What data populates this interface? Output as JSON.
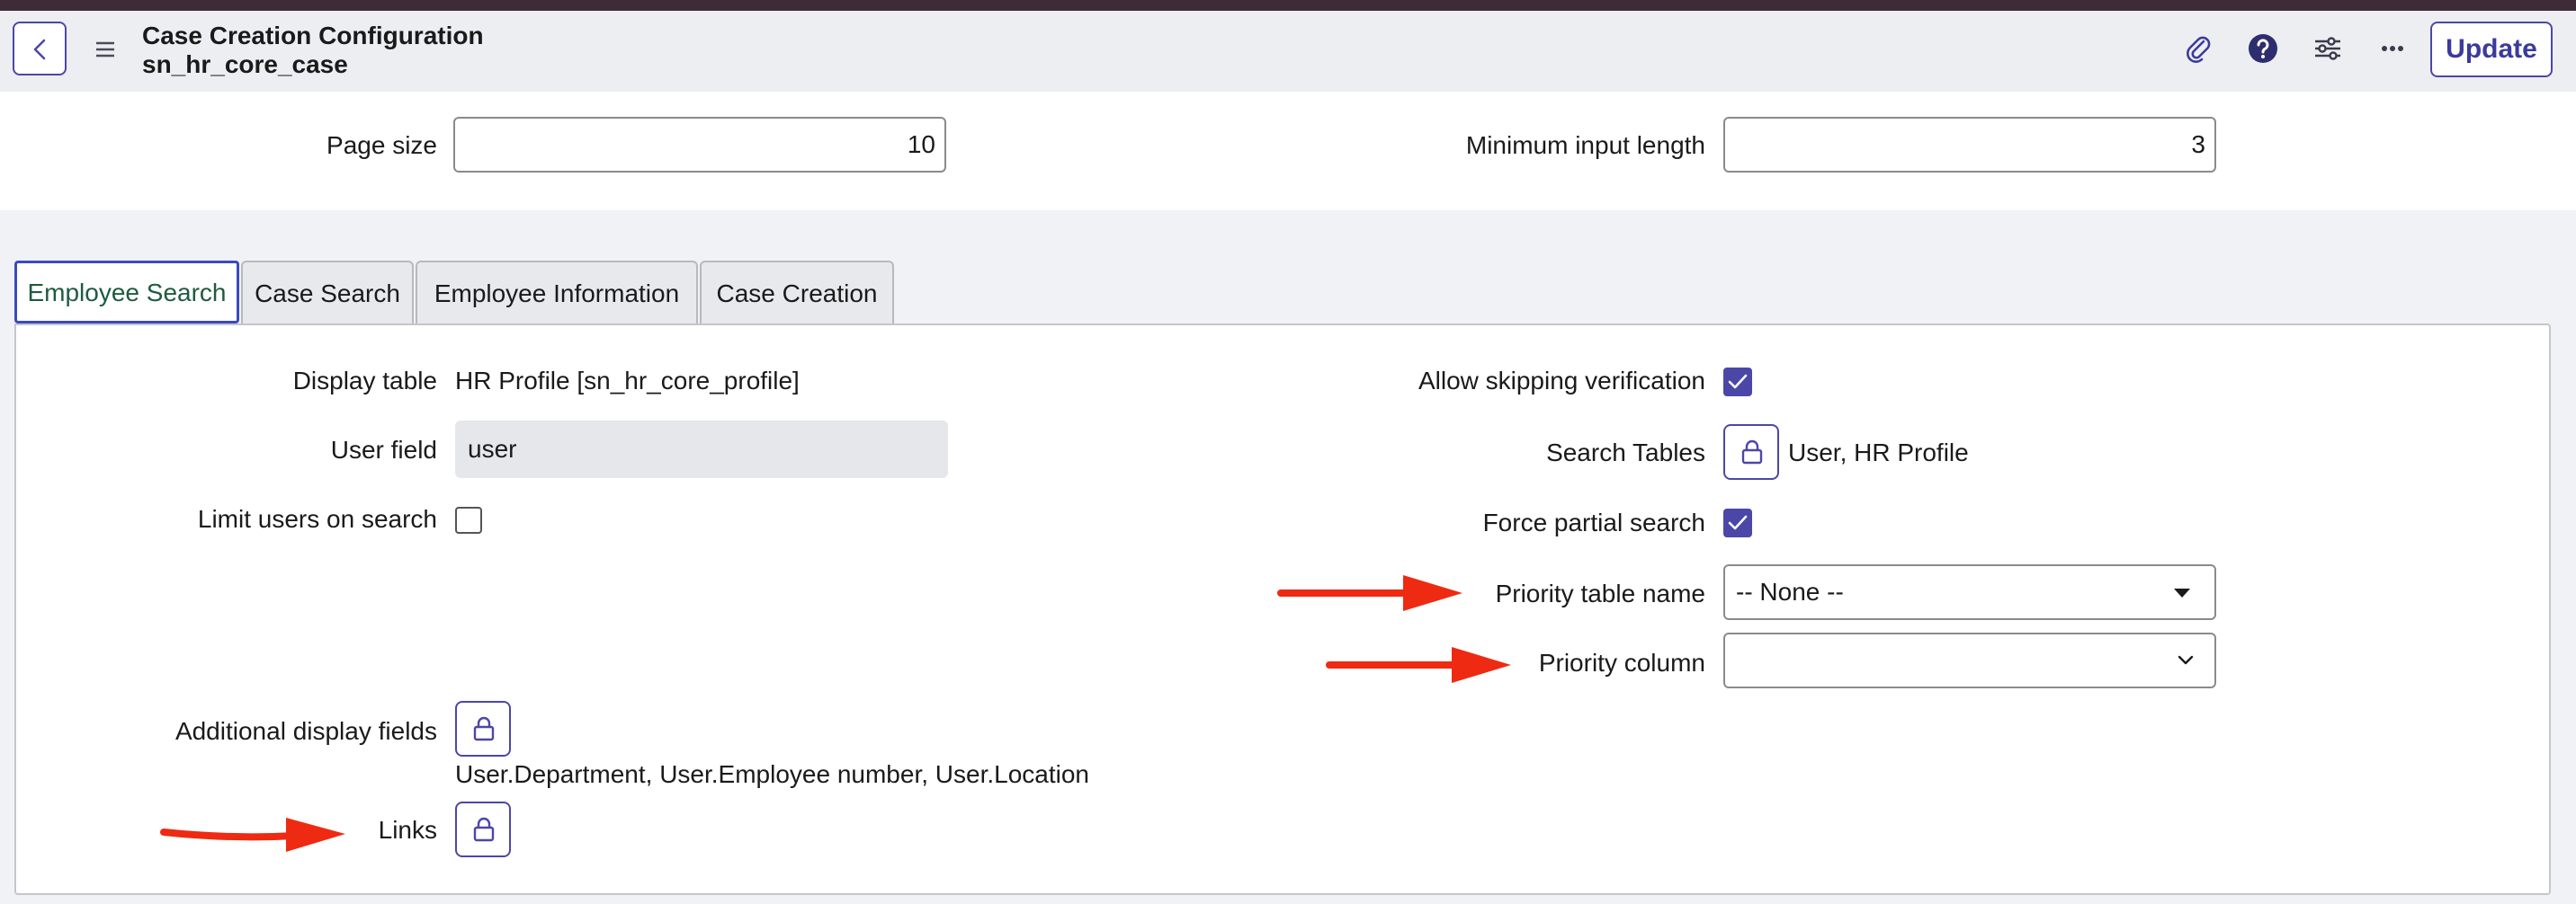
{
  "header": {
    "title": "Case Creation Configuration",
    "subtitle": "sn_hr_core_case",
    "icons": [
      "back-icon",
      "menu-icon",
      "paperclip-icon",
      "help-icon",
      "sliders-icon",
      "more-icon"
    ],
    "update_label": "Update"
  },
  "top_fields": {
    "page_size_label": "Page size",
    "page_size_value": "10",
    "min_input_label": "Minimum input length",
    "min_input_value": "3"
  },
  "tabs": [
    {
      "label": "Employee Search",
      "active": true
    },
    {
      "label": "Case Search",
      "active": false
    },
    {
      "label": "Employee Information",
      "active": false
    },
    {
      "label": "Case Creation",
      "active": false
    }
  ],
  "left": {
    "display_table_label": "Display table",
    "display_table_value": "HR Profile [sn_hr_core_profile]",
    "user_field_label": "User field",
    "user_field_value": "user",
    "limit_users_label": "Limit users on search",
    "limit_users_checked": false,
    "additional_display_label": "Additional display fields",
    "additional_display_value": "User.Department, User.Employee number, User.Location",
    "links_label": "Links"
  },
  "right": {
    "allow_skip_label": "Allow skipping verification",
    "allow_skip_checked": true,
    "search_tables_label": "Search Tables",
    "search_tables_value": "User, HR Profile",
    "force_partial_label": "Force partial search",
    "force_partial_checked": true,
    "priority_table_label": "Priority table name",
    "priority_table_value": "-- None --",
    "priority_column_label": "Priority column",
    "priority_column_value": ""
  },
  "colors": {
    "accent": "#4b47a8",
    "annotation_arrow": "#ee2a12",
    "active_tab_text": "#1f5b3e",
    "header_bg": "#eceef2",
    "topbar": "#3d2c37"
  }
}
